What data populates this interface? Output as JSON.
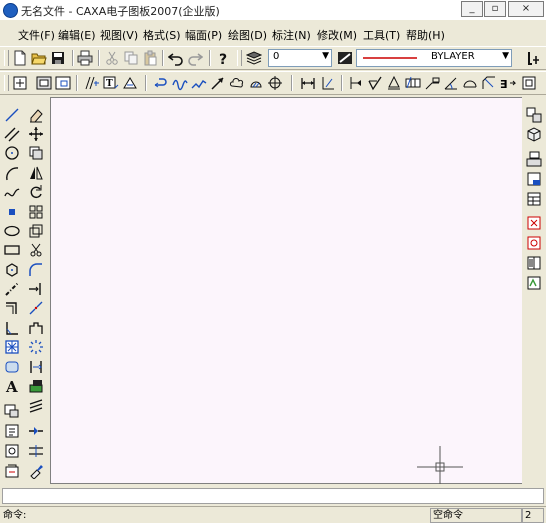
{
  "window": {
    "title": "无名文件 - CAXA电子图板2007(企业版)",
    "min_label": "_",
    "max_label": "▫",
    "close_label": "×"
  },
  "menu": [
    "文件(F)",
    "编辑(E)",
    "视图(V)",
    "格式(S)",
    "幅面(P)",
    "绘图(D)",
    "标注(N)",
    "修改(M)",
    "工具(T)",
    "帮助(H)"
  ],
  "properties": {
    "layer_value": "0",
    "linetype_value": "BYLAYER"
  },
  "status": {
    "command_prompt": "命令:",
    "empty_command": "空命令",
    "count": "2"
  },
  "colors": {
    "canvas": "#fcf5fc",
    "chrome": "#ece9d8",
    "accent_red": "#cc0000",
    "icon_blue": "#1a4fbf"
  }
}
